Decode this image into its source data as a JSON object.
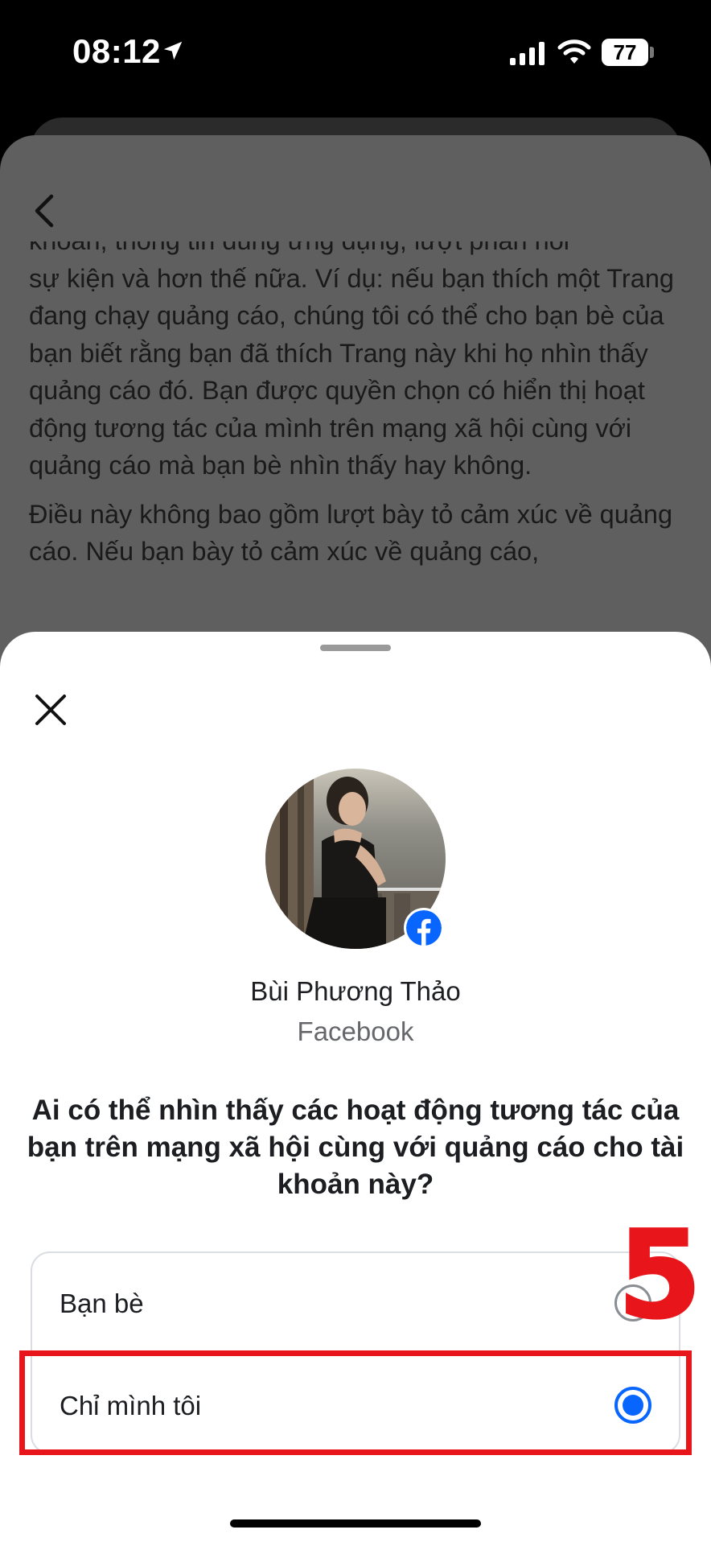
{
  "status_bar": {
    "time": "08:12",
    "battery": "77"
  },
  "background_page": {
    "paragraph_1_clipped": "khoản, thông tin dùng ứng dụng, lượt phản hồi",
    "paragraph_1": "sự kiện và hơn thế nữa. Ví dụ: nếu bạn thích một Trang đang chạy quảng cáo, chúng tôi có thể cho bạn bè của bạn biết rằng bạn đã thích Trang này khi họ nhìn thấy quảng cáo đó. Bạn được quyền chọn có hiển thị hoạt động tương tác của mình trên mạng xã hội cùng với quảng cáo mà bạn bè nhìn thấy hay không.",
    "paragraph_2": "Điều này không bao gồm lượt bày tỏ cảm xúc về quảng cáo. Nếu bạn bày tỏ cảm xúc về quảng cáo,"
  },
  "sheet": {
    "account_name": "Bùi Phương Thảo",
    "account_platform": "Facebook",
    "question": "Ai có thể nhìn thấy các hoạt động tương tác của bạn trên mạng xã hội cùng với quảng cáo cho tài khoản này?",
    "options": [
      {
        "label": "Bạn bè",
        "selected": false
      },
      {
        "label": "Chỉ mình tôi",
        "selected": true
      }
    ]
  },
  "annotation": {
    "step_number": "5",
    "color": "#e8151b"
  },
  "colors": {
    "accent": "#0866ff",
    "facebook_blue": "#0866ff"
  },
  "icons": [
    "location-arrow-icon",
    "signal-icon",
    "wifi-icon",
    "battery-icon",
    "back-arrow-icon",
    "close-icon",
    "facebook-icon"
  ]
}
